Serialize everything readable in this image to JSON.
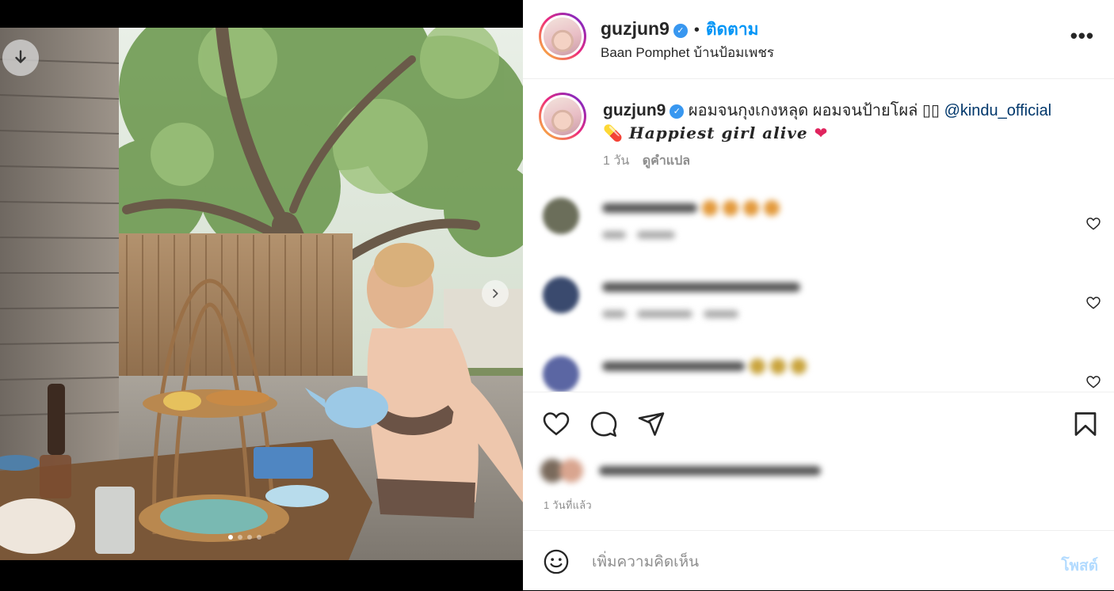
{
  "post": {
    "username": "guzjun9",
    "verified": true,
    "separator": "•",
    "follow_label": "ติดตาม",
    "location": "Baan Pomphet บ้านป้อมเพชร",
    "more_icon": "more-horizontal-icon"
  },
  "caption": {
    "username": "guzjun9",
    "text": " ผอมจนกุงเกงหลุด ผอมจนป้ายโผล่ ",
    "mention": "@kindu_official",
    "line2_prefix_emoji": "💊",
    "line2_text": " Happiest girl alive ",
    "line2_suffix_emoji": "❤",
    "age": "1 วัน",
    "translate_label": "ดูคำแปล"
  },
  "media": {
    "download_icon": "download-icon",
    "next_icon": "chevron-right-icon",
    "slide_count": 4,
    "active_slide": 1
  },
  "comments": [
    {
      "blurred": true,
      "avatar_color": "#6b6e5a"
    },
    {
      "blurred": true,
      "avatar_color": "#3a4a6e"
    },
    {
      "blurred": true,
      "avatar_color": "#5b66a3"
    }
  ],
  "actions": {
    "like_icon": "heart-icon",
    "comment_icon": "comment-bubble-icon",
    "share_icon": "send-icon",
    "save_icon": "bookmark-icon"
  },
  "timeago": "1 วันที่แล้ว",
  "comment_box": {
    "emoji_icon": "smiley-icon",
    "placeholder": "เพิ่มความคิดเห็น",
    "post_label": "โพสต์"
  },
  "colors": {
    "accent": "#0095f6",
    "mention": "#00376b",
    "muted": "#8e8e8e",
    "post_disabled": "#b3dbff"
  }
}
